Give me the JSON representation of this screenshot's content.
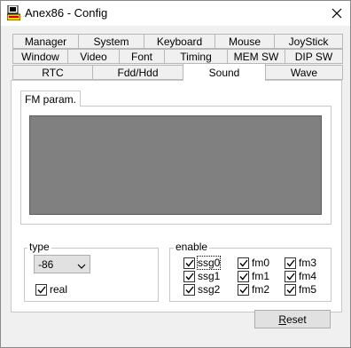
{
  "window": {
    "title": "Anex86 - Config"
  },
  "tabs": {
    "row1": [
      "Manager",
      "System",
      "Keyboard",
      "Mouse",
      "JoyStick"
    ],
    "row2": [
      "Window",
      "Video",
      "Font",
      "Timing",
      "MEM SW",
      "DIP SW"
    ],
    "row3": [
      "RTC",
      "Fdd/Hdd",
      "Sound",
      "Wave"
    ],
    "active": "Sound"
  },
  "sound": {
    "inner_tab": "FM param.",
    "type_group": {
      "label": "type",
      "selected": "-86",
      "real_label": "real",
      "real_checked": true
    },
    "enable_group": {
      "label": "enable",
      "items": [
        {
          "label": "ssg0",
          "checked": true
        },
        {
          "label": "fm0",
          "checked": true
        },
        {
          "label": "fm3",
          "checked": true
        },
        {
          "label": "ssg1",
          "checked": true
        },
        {
          "label": "fm1",
          "checked": true
        },
        {
          "label": "fm4",
          "checked": true
        },
        {
          "label": "ssg2",
          "checked": true
        },
        {
          "label": "fm2",
          "checked": true
        },
        {
          "label": "fm5",
          "checked": true
        }
      ]
    },
    "reset_mnemonic": "R",
    "reset_rest": "eset"
  },
  "colors": {
    "window_bg": "#f0f0f0",
    "panel_bg": "#ffffff",
    "display_bg": "#808080"
  }
}
